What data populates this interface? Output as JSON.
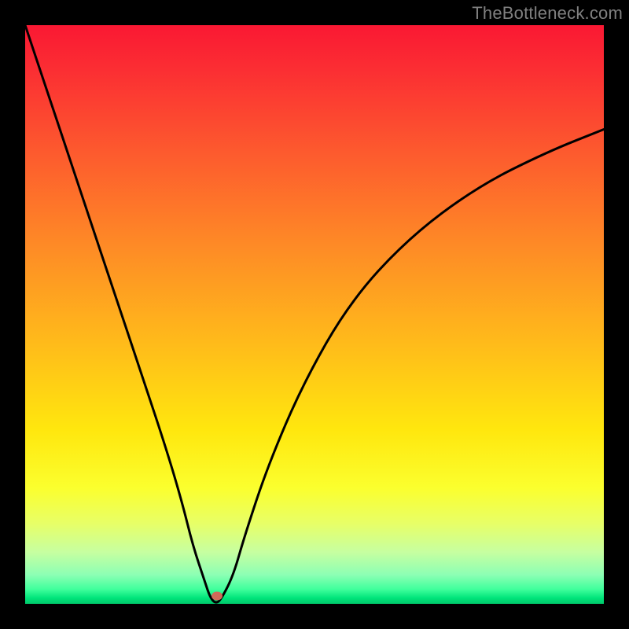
{
  "watermark": "TheBottleneck.com",
  "chart_data": {
    "type": "line",
    "title": "",
    "xlabel": "",
    "ylabel": "",
    "xlim": [
      0,
      100
    ],
    "ylim": [
      0,
      100
    ],
    "series": [
      {
        "name": "curve",
        "x": [
          0,
          4,
          8,
          12,
          16,
          20,
          24,
          27,
          29,
          31,
          32,
          33,
          34,
          36,
          38,
          42,
          48,
          56,
          66,
          78,
          90,
          100
        ],
        "values": [
          100,
          88,
          76,
          64,
          52,
          40,
          28,
          18,
          10,
          4,
          1,
          0,
          1,
          5,
          12,
          24,
          38,
          52,
          63,
          72,
          78,
          82
        ]
      }
    ],
    "marker": {
      "x": 33.2,
      "y": 1.4
    },
    "background_gradient": {
      "top": "#fa1833",
      "bottom": "#00c86b"
    }
  }
}
